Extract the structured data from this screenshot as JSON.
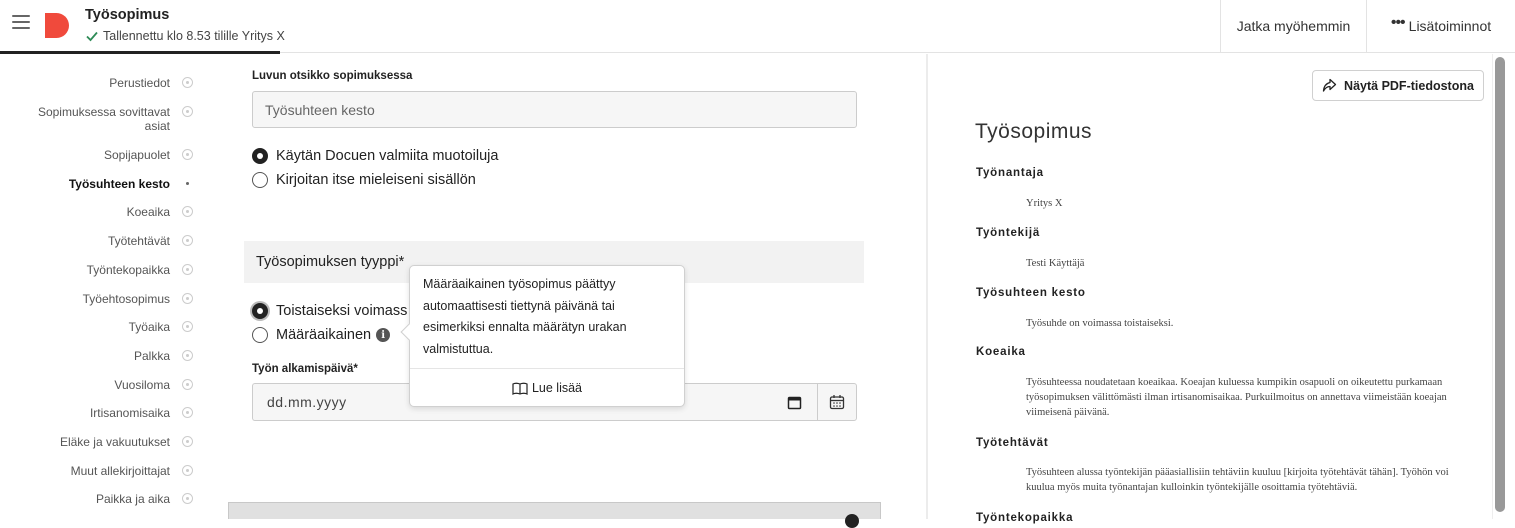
{
  "header": {
    "title": "Työsopimus",
    "save_status": "Tallennettu klo 8.53 tilille Yritys X",
    "continue_later": "Jatka myöhemmin",
    "more_actions": "Lisätoiminnot"
  },
  "nav": {
    "items": [
      {
        "label": "Perustiedot"
      },
      {
        "label": "Sopimuksessa sovittavat asiat"
      },
      {
        "label": "Sopijapuolet"
      },
      {
        "label": "Työsuhteen kesto"
      },
      {
        "label": "Koeaika"
      },
      {
        "label": "Työtehtävät"
      },
      {
        "label": "Työntekopaikka"
      },
      {
        "label": "Työehtosopimus"
      },
      {
        "label": "Työaika"
      },
      {
        "label": "Palkka"
      },
      {
        "label": "Vuosiloma"
      },
      {
        "label": "Irtisanomisaika"
      },
      {
        "label": "Eläke ja vakuutukset"
      },
      {
        "label": "Muut allekirjoittajat"
      },
      {
        "label": "Paikka ja aika"
      }
    ]
  },
  "form": {
    "heading_label": "Luvun otsikko sopimuksessa",
    "heading_value": "Työsuhteen kesto",
    "format_options": [
      "Käytän Docuen valmiita muotoiluja",
      "Kirjoitan itse mieleiseni sisällön"
    ],
    "type_section": "Työsopimuksen tyyppi*",
    "type_options": [
      "Toistaiseksi voimass",
      "Määräaikainen"
    ],
    "start_label": "Työn alkamispäivä*",
    "start_placeholder": "dd.mm.yyyy"
  },
  "tooltip": {
    "text": "Määräaikainen työsopimus päättyy automaattisesti tiettynä päivänä tai esimerkiksi ennalta määrätyn urakan valmistuttua.",
    "link": "Lue lisää"
  },
  "preview": {
    "pdf_button": "Näytä PDF-tiedostona",
    "title": "Työsopimus",
    "employer_head": "Työnantaja",
    "employer": "Yritys X",
    "employee_head": "Työntekijä",
    "employee": "Testi Käyttäjä",
    "duration_head": "Työsuhteen kesto",
    "duration": "Työsuhde on voimassa toistaiseksi.",
    "probation_head": "Koeaika",
    "probation": "Työsuhteessa noudatetaan koeaikaa. Koeajan kuluessa kumpikin osapuoli on oikeutettu purkamaan työsopimuksen välittömästi ilman irtisanomisaikaa. Purkuilmoitus on annettava viimeistään koeajan viimeisenä päivänä.",
    "tasks_head": "Työtehtävät",
    "tasks": "Työsuhteen alussa työntekijän pääasiallisiin tehtäviin kuuluu [kirjoita työtehtävät tähän]. Työhön voi kuulua myös muita työnantajan kulloinkin työntekijälle osoittamia työtehtäviä.",
    "workplace_head": "Työntekopaikka"
  },
  "colors": {
    "brand": "#f04a3c",
    "check": "#2e8b57"
  }
}
